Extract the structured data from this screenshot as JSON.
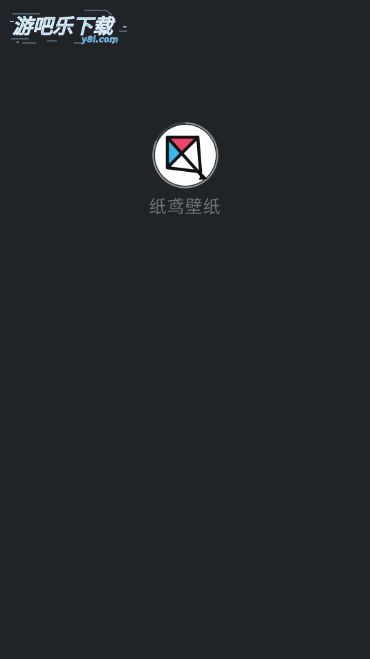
{
  "watermark": {
    "brand_text": "游吧乐下载",
    "site_text": "y8l.com"
  },
  "splash": {
    "app_name": "纸鸢壁纸"
  },
  "colors": {
    "background": "#212427",
    "app_name": "#6f7276",
    "kite_pink": "#f0446a",
    "kite_blue": "#35b9ef",
    "watermark_blue": "#2f9fe6"
  }
}
